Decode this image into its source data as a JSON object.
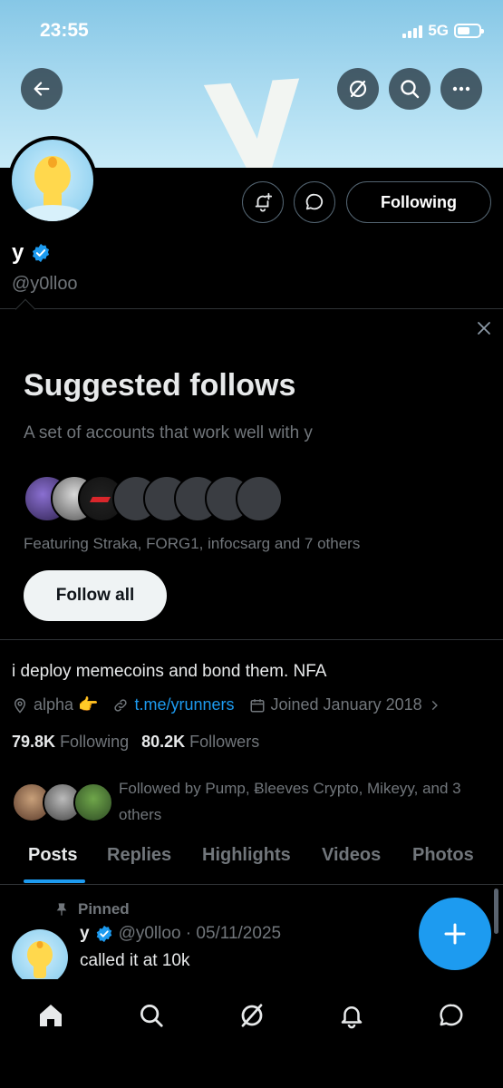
{
  "status_bar": {
    "time": "23:55",
    "network": "5G"
  },
  "profile": {
    "banner_text": "y",
    "name": "y",
    "handle": "@y0lloo",
    "following_button": "Following",
    "bio": "i deploy memecoins and bond them. NFA",
    "location": "alpha 👉",
    "link": "t.me/yrunners",
    "joined": "Joined January 2018",
    "following_count": "79.8K",
    "following_label": "Following",
    "followers_count": "80.2K",
    "followers_label": "Followers",
    "followed_by": "Followed by Pump, Ƀleeves Crypto, Mikeyy, and 3 others"
  },
  "suggested": {
    "title": "Suggested follows",
    "subtitle": "A set of accounts that work well with y",
    "featuring": "Featuring Straka, FORG1, infocsarg and 7 others",
    "follow_all": "Follow all"
  },
  "tabs": [
    "Posts",
    "Replies",
    "Highlights",
    "Videos",
    "Photos"
  ],
  "active_tab": "Posts",
  "pinned_post": {
    "pinned_label": "Pinned",
    "author": "y",
    "meta": "@y0lloo · 05/11/2025",
    "text": "called it at 10k"
  },
  "colors": {
    "accent": "#1d9bf0",
    "background": "#000000",
    "muted": "#71767b"
  },
  "icons": {
    "back": "back-arrow-icon",
    "grok": "grok-icon",
    "search": "search-icon",
    "more": "more-icon",
    "notify": "notification-add-icon",
    "message": "message-icon",
    "verified": "verified-badge-icon",
    "location": "location-icon",
    "link": "link-icon",
    "calendar": "calendar-icon",
    "compose": "plus-icon",
    "home": "home-icon",
    "bell": "bell-icon",
    "chat": "chat-icon"
  }
}
